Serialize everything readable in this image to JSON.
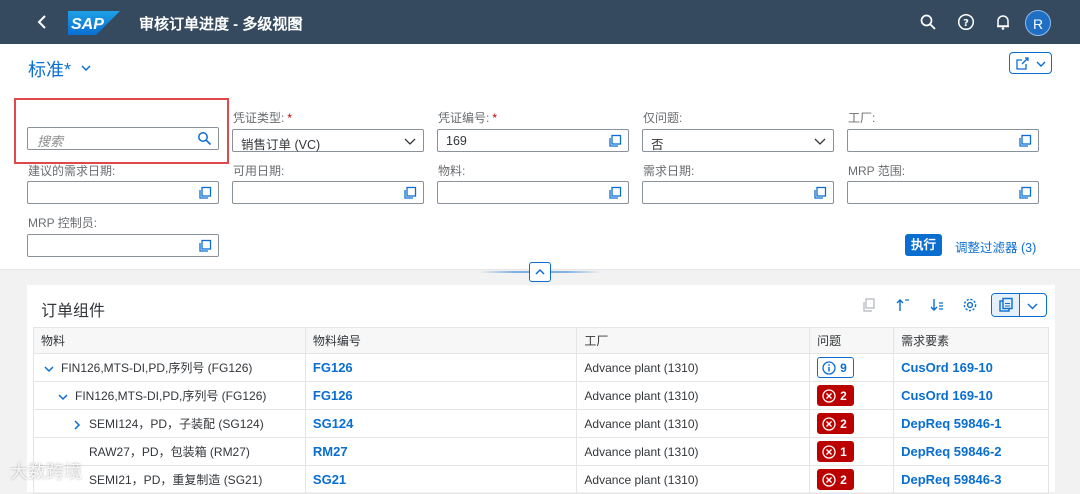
{
  "shell": {
    "title": "审核订单进度 - 多级视图",
    "logo_text": "SAP",
    "avatar_initial": "R"
  },
  "filterbar": {
    "variant_name": "标准*",
    "search_placeholder": "搜索",
    "fields": [
      {
        "label": "凭证类型:",
        "required": "*",
        "value": "销售订单 (VC)"
      },
      {
        "label": "凭证编号:",
        "required": "*",
        "value": "169"
      },
      {
        "label": "仅问题:",
        "value": "否"
      },
      {
        "label": "工厂:",
        "value": ""
      },
      {
        "label": "建议的需求日期:",
        "value": ""
      },
      {
        "label": "可用日期:",
        "value": ""
      },
      {
        "label": "物料:",
        "value": ""
      },
      {
        "label": "需求日期:",
        "value": ""
      },
      {
        "label": "MRP 范围:",
        "value": ""
      },
      {
        "label": "MRP 控制员:",
        "value": ""
      }
    ],
    "execute_label": "执行",
    "adapt_label": "调整过滤器 (3)"
  },
  "table": {
    "title": "订单组件",
    "columns": [
      "物料",
      "物料编号",
      "工厂",
      "问题",
      "需求要素"
    ],
    "rows": [
      {
        "material": "FIN126,MTS-DI,PD,序列号 (FG126)",
        "number": "FG126",
        "plant": "Advance plant (1310)",
        "issue_type": "info",
        "issue_count": "9",
        "req": "CusOrd 169-10",
        "tree": "expanded"
      },
      {
        "material": "FIN126,MTS-DI,PD,序列号 (FG126)",
        "number": "FG126",
        "plant": "Advance plant (1310)",
        "issue_type": "error",
        "issue_count": "2",
        "req": "CusOrd 169-10",
        "tree": "expanded"
      },
      {
        "material": "SEMI124，PD，子装配 (SG124)",
        "number": "SG124",
        "plant": "Advance plant (1310)",
        "issue_type": "error",
        "issue_count": "2",
        "req": "DepReq 59846-1",
        "tree": "collapsed"
      },
      {
        "material": "RAW27，PD，包装箱 (RM27)",
        "number": "RM27",
        "plant": "Advance plant (1310)",
        "issue_type": "error",
        "issue_count": "1",
        "req": "DepReq 59846-2",
        "tree": "none"
      },
      {
        "material": "SEMI21，PD，重复制造 (SG21)",
        "number": "SG21",
        "plant": "Advance plant (1310)",
        "issue_type": "error",
        "issue_count": "2",
        "req": "DepReq 59846-3",
        "tree": "none"
      }
    ]
  },
  "watermark": "大数跨境",
  "colors": {
    "shell": "#354a5f",
    "accent": "#0a6ed1",
    "error": "#bb0000"
  }
}
